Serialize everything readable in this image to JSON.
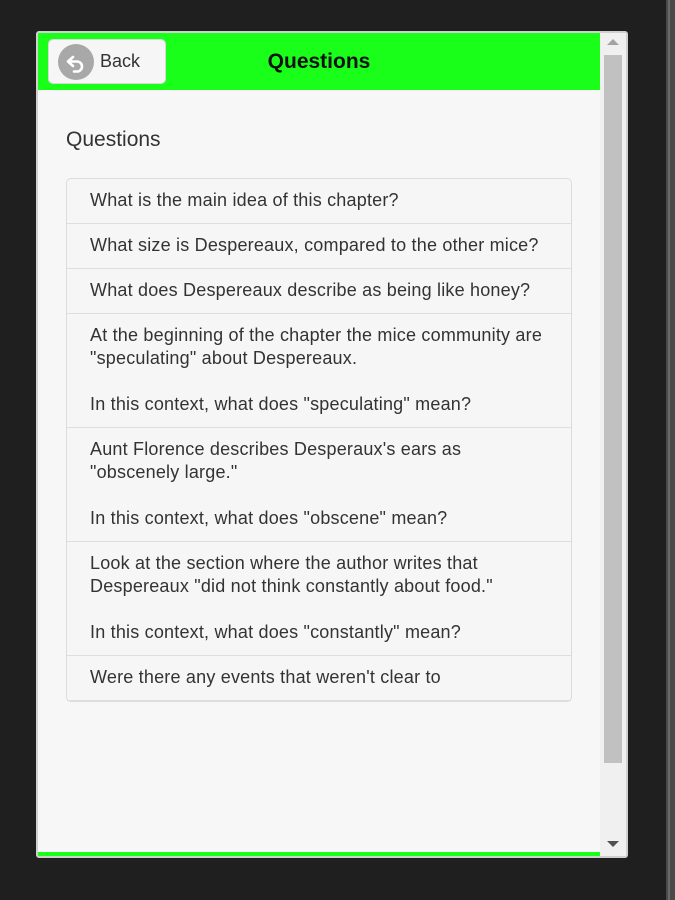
{
  "header": {
    "back_label": "Back",
    "title": "Questions"
  },
  "icons": {
    "back": "back-arrow-icon"
  },
  "colors": {
    "header_bg": "#19ff19",
    "page_bg": "#1f1f1f"
  },
  "section": {
    "heading": "Questions"
  },
  "questions": [
    "What is the main idea of this chapter?",
    "What size is Despereaux, compared to the other mice?",
    "What does Despereaux describe as being like honey?",
    "At the beginning of the chapter the mice community are \"speculating\" about Despereaux.\n\nIn this context, what does \"speculating\" mean?",
    "Aunt Florence describes Desperaux's ears as \"obscenely large.\"\n\nIn this context, what does \"obscene\" mean?",
    "Look at the section where the author writes that Despereaux \"did not think constantly about food.\"\n\nIn this context, what does \"constantly\" mean?",
    "Were there any events that weren't clear to"
  ]
}
